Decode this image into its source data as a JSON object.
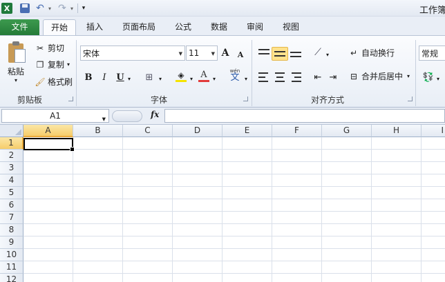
{
  "window": {
    "title": "工作簿"
  },
  "quick_access": {
    "app_icon": "X"
  },
  "tabs": [
    {
      "label": "文件"
    },
    {
      "label": "开始"
    },
    {
      "label": "插入"
    },
    {
      "label": "页面布局"
    },
    {
      "label": "公式"
    },
    {
      "label": "数据"
    },
    {
      "label": "审阅"
    },
    {
      "label": "视图"
    }
  ],
  "clipboard": {
    "paste": "粘贴",
    "cut": "剪切",
    "copy": "复制",
    "format_painter": "格式刷",
    "group": "剪贴板"
  },
  "font": {
    "name": "宋体",
    "size": "11",
    "group": "字体",
    "bold": "B",
    "italic": "I",
    "underline": "U",
    "grow": "A",
    "shrink": "A",
    "phonetic_top": "wén",
    "phonetic": "文",
    "font_color_letter": "A"
  },
  "alignment": {
    "wrap_text": "自动换行",
    "merge_center": "合并后居中",
    "group": "对齐方式"
  },
  "number": {
    "format": "常规"
  },
  "formula_bar": {
    "name_box": "A1",
    "fx": "fx",
    "value": ""
  },
  "sheet": {
    "columns": [
      "A",
      "B",
      "C",
      "D",
      "E",
      "F",
      "G",
      "H",
      "I"
    ],
    "rows": [
      "1",
      "2",
      "3",
      "4",
      "5",
      "6",
      "7",
      "8",
      "9",
      "10",
      "11",
      "12"
    ],
    "active_cell": "A1"
  },
  "colors": {
    "file_tab": "#2f8a43",
    "selection_header": "#f6cd6b",
    "font_color": "#e23b3b",
    "fill_color": "#f5e400"
  }
}
